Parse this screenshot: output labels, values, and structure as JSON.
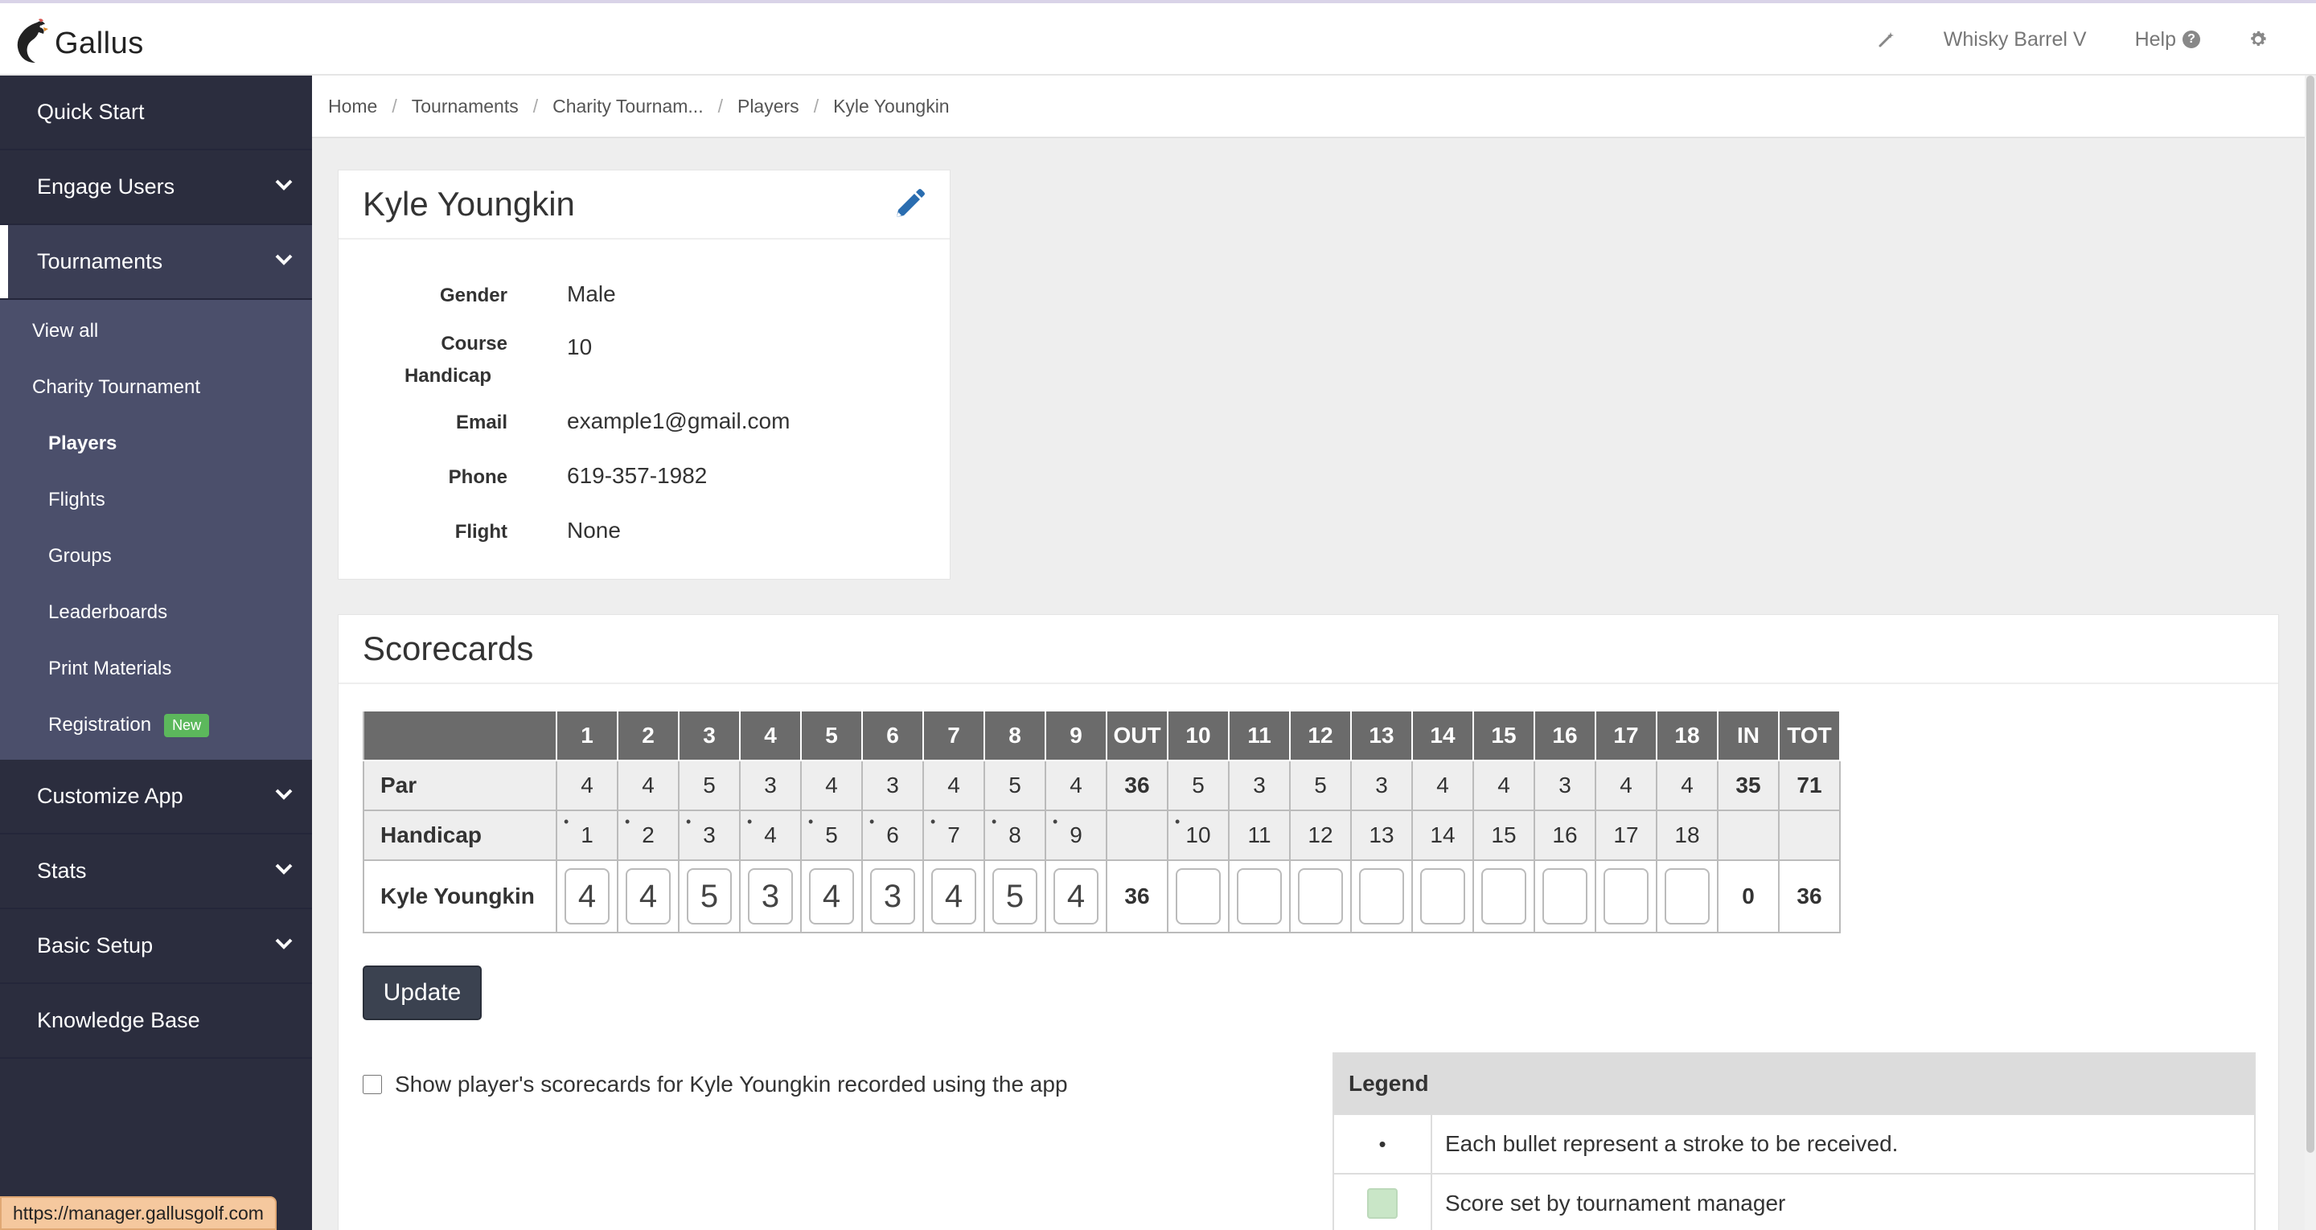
{
  "app": {
    "name": "Gallus"
  },
  "topbar": {
    "org": "Whisky Barrel V",
    "help": "Help",
    "help_glyph": "?",
    "icons": [
      "magic-wand-icon",
      "gear-icon"
    ]
  },
  "sidebar": {
    "items": [
      {
        "label": "Quick Start"
      },
      {
        "label": "Engage Users"
      },
      {
        "label": "Tournaments"
      },
      {
        "label": "Customize App"
      },
      {
        "label": "Stats"
      },
      {
        "label": "Basic Setup"
      },
      {
        "label": "Knowledge Base"
      }
    ],
    "tournaments_sub": {
      "view_all": "View all",
      "tournament": "Charity Tournament",
      "players": "Players",
      "flights": "Flights",
      "groups": "Groups",
      "leaderboards": "Leaderboards",
      "print_materials": "Print Materials",
      "registration": "Registration",
      "new_badge": "New"
    }
  },
  "breadcrumb": [
    "Home",
    "Tournaments",
    "Charity Tournam...",
    "Players",
    "Kyle Youngkin"
  ],
  "player": {
    "name": "Kyle Youngkin",
    "labels": {
      "gender": "Gender",
      "course": "Course",
      "handicap": "Handicap",
      "email": "Email",
      "phone": "Phone",
      "flight": "Flight"
    },
    "values": {
      "gender": "Male",
      "course_handicap": "10",
      "email": "example1@gmail.com",
      "phone": "619-357-1982",
      "flight": "None"
    }
  },
  "scorecards": {
    "title": "Scorecards",
    "headers": [
      "",
      "1",
      "2",
      "3",
      "4",
      "5",
      "6",
      "7",
      "8",
      "9",
      "OUT",
      "10",
      "11",
      "12",
      "13",
      "14",
      "15",
      "16",
      "17",
      "18",
      "IN",
      "TOT"
    ],
    "par_label": "Par",
    "par": [
      "4",
      "4",
      "5",
      "3",
      "4",
      "3",
      "4",
      "5",
      "4",
      "36",
      "5",
      "3",
      "5",
      "3",
      "4",
      "4",
      "3",
      "4",
      "4",
      "35",
      "71"
    ],
    "handicap_label": "Handicap",
    "handicap": [
      "1",
      "2",
      "3",
      "4",
      "5",
      "6",
      "7",
      "8",
      "9",
      "",
      "10",
      "11",
      "12",
      "13",
      "14",
      "15",
      "16",
      "17",
      "18",
      "",
      ""
    ],
    "handicap_strokes": [
      1,
      1,
      1,
      1,
      1,
      1,
      1,
      1,
      1,
      0,
      1,
      0,
      0,
      0,
      0,
      0,
      0,
      0,
      0,
      0,
      0
    ],
    "player_label": "Kyle Youngkin",
    "front_scores": [
      "4",
      "4",
      "5",
      "3",
      "4",
      "3",
      "4",
      "5",
      "4"
    ],
    "out": "36",
    "back_scores": [
      "",
      "",
      "",
      "",
      "",
      "",
      "",
      "",
      ""
    ],
    "in": "0",
    "tot": "36",
    "update_label": "Update",
    "show_label": "Show player's scorecards for Kyle Youngkin recorded using the app",
    "legend": {
      "title": "Legend",
      "bullet_symbol": "•",
      "bullet_text": "Each bullet represent a stroke to be received.",
      "manager_text": "Score set by tournament manager",
      "manager_color": "#c9e6c7"
    }
  },
  "status_url": "https://manager.gallusgolf.com"
}
